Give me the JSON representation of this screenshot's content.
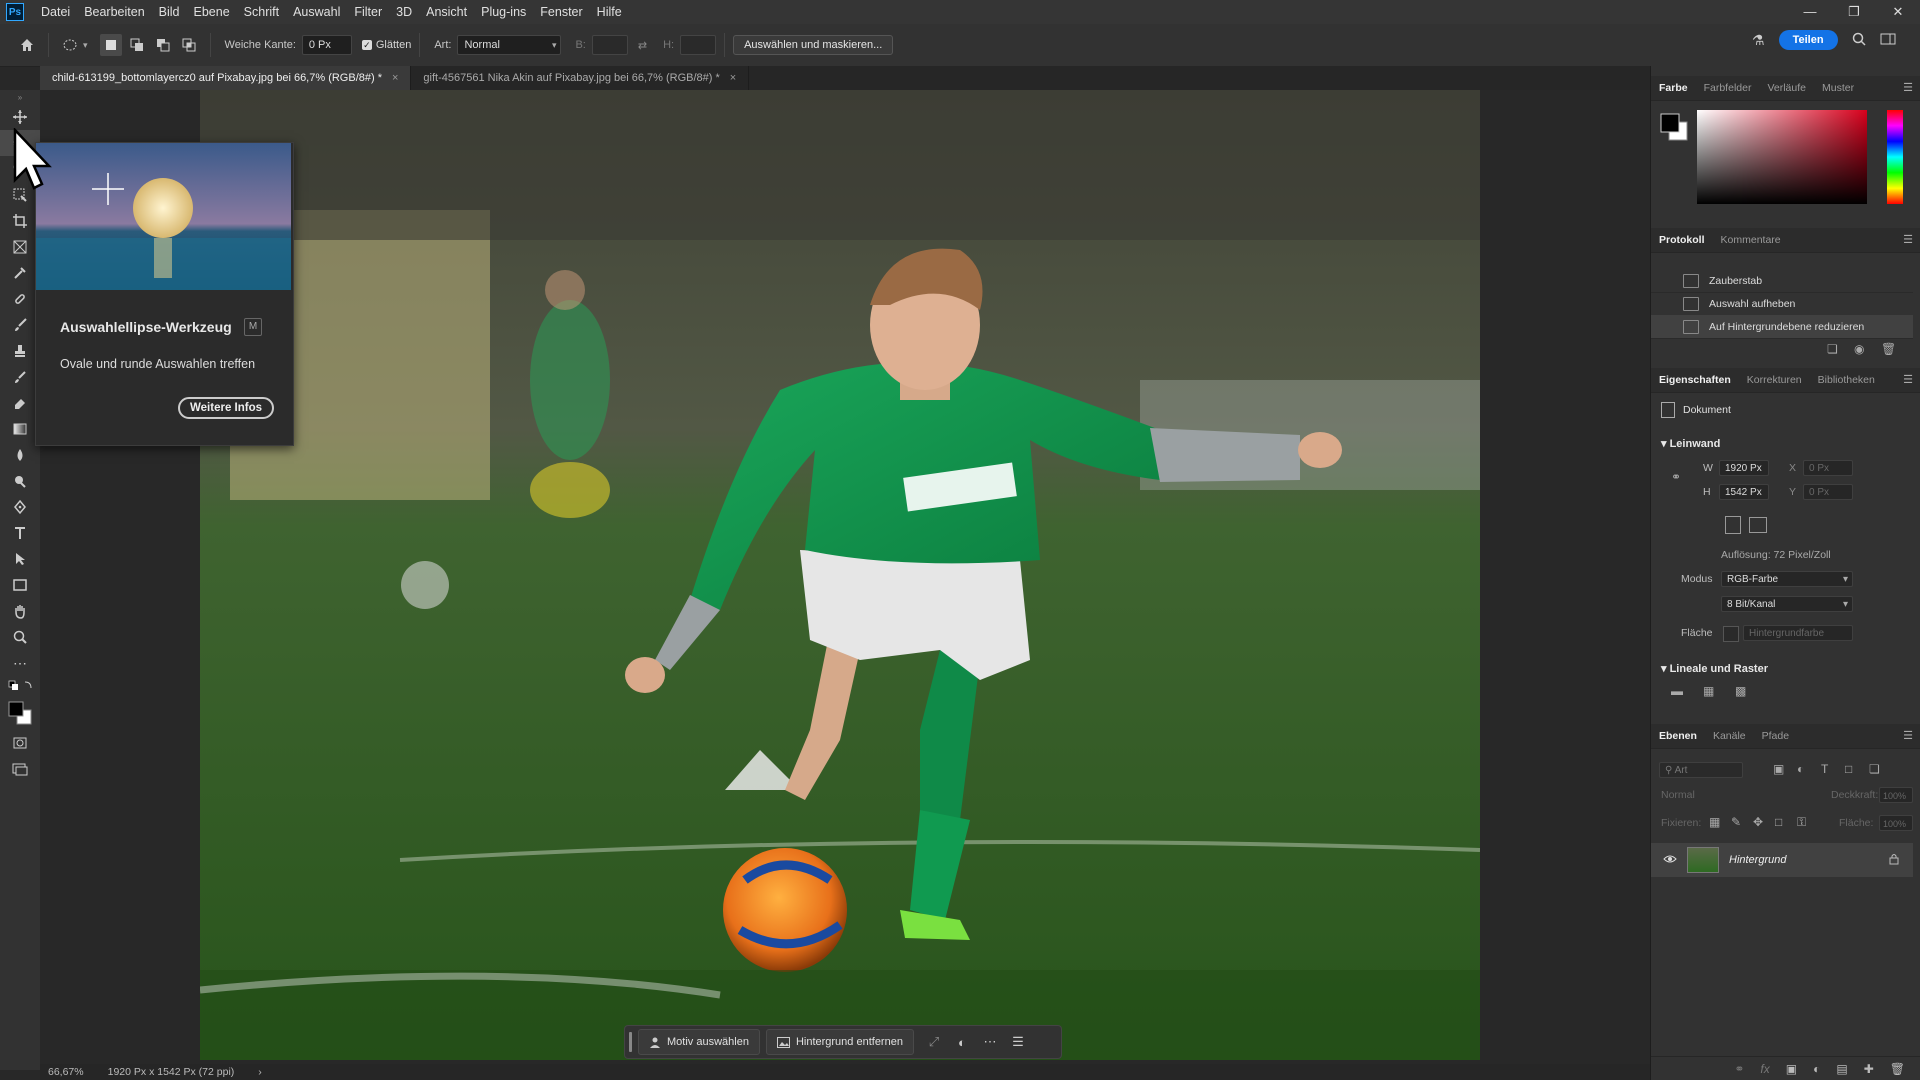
{
  "app": {
    "logo": "Ps"
  },
  "menu": [
    "Datei",
    "Bearbeiten",
    "Bild",
    "Ebene",
    "Schrift",
    "Auswahl",
    "Filter",
    "3D",
    "Ansicht",
    "Plug-ins",
    "Fenster",
    "Hilfe"
  ],
  "options": {
    "feather_label": "Weiche Kante:",
    "feather_value": "0 Px",
    "antialias_label": "Glätten",
    "style_label": "Art:",
    "style_value": "Normal",
    "width_label": "B:",
    "height_label": "H:",
    "select_mask_label": "Auswählen und maskieren...",
    "share_label": "Teilen"
  },
  "tabs": [
    {
      "label": "child-613199_bottomlayercz0 auf Pixabay.jpg bei 66,7% (RGB/8#) *",
      "close": "×"
    },
    {
      "label": "gift-4567561 Nika Akin auf Pixabay.jpg bei 66,7% (RGB/8#) *",
      "close": "×"
    }
  ],
  "tooltip": {
    "title": "Auswahlellipse-Werkzeug",
    "shortcut": "M",
    "description": "Ovale und runde Auswahlen treffen",
    "more_label": "Weitere Infos"
  },
  "context_bar": {
    "select_subject": "Motiv auswählen",
    "remove_bg": "Hintergrund entfernen"
  },
  "status": {
    "zoom": "66,67%",
    "doc_info": "1920 Px x 1542 Px (72 ppi)"
  },
  "color_panel": {
    "tabs": [
      "Farbe",
      "Farbfelder",
      "Verläufe",
      "Muster"
    ]
  },
  "history_panel": {
    "tabs": [
      "Protokoll",
      "Kommentare"
    ],
    "items": [
      "Zauberstab",
      "Auswahl aufheben",
      "Auf Hintergrundebene reduzieren"
    ]
  },
  "properties_panel": {
    "tabs": [
      "Eigenschaften",
      "Korrekturen",
      "Bibliotheken"
    ],
    "doc_label": "Dokument",
    "canvas_section": "Leinwand",
    "w_label": "W",
    "w_value": "1920 Px",
    "h_label": "H",
    "h_value": "1542 Px",
    "x_label": "X",
    "x_value": "0 Px",
    "y_label": "Y",
    "y_value": "0 Px",
    "resolution": "Auflösung: 72 Pixel/Zoll",
    "mode_label": "Modus",
    "mode_value": "RGB-Farbe",
    "depth_value": "8 Bit/Kanal",
    "fill_label": "Fläche",
    "fill_value": "Hintergrundfarbe",
    "rulers_section": "Lineale und Raster"
  },
  "layers_panel": {
    "tabs": [
      "Ebenen",
      "Kanäle",
      "Pfade"
    ],
    "search_placeholder": "Art",
    "blend_mode": "Normal",
    "opacity_label": "Deckkraft:",
    "opacity_value": "100%",
    "lock_label": "Fixieren:",
    "fill_label": "Fläche:",
    "fill_value": "100%",
    "layers": [
      {
        "name": "Hintergrund"
      }
    ]
  },
  "colors": {
    "accent": "#1473e6",
    "foreground": "#000000",
    "background": "#ffffff"
  }
}
